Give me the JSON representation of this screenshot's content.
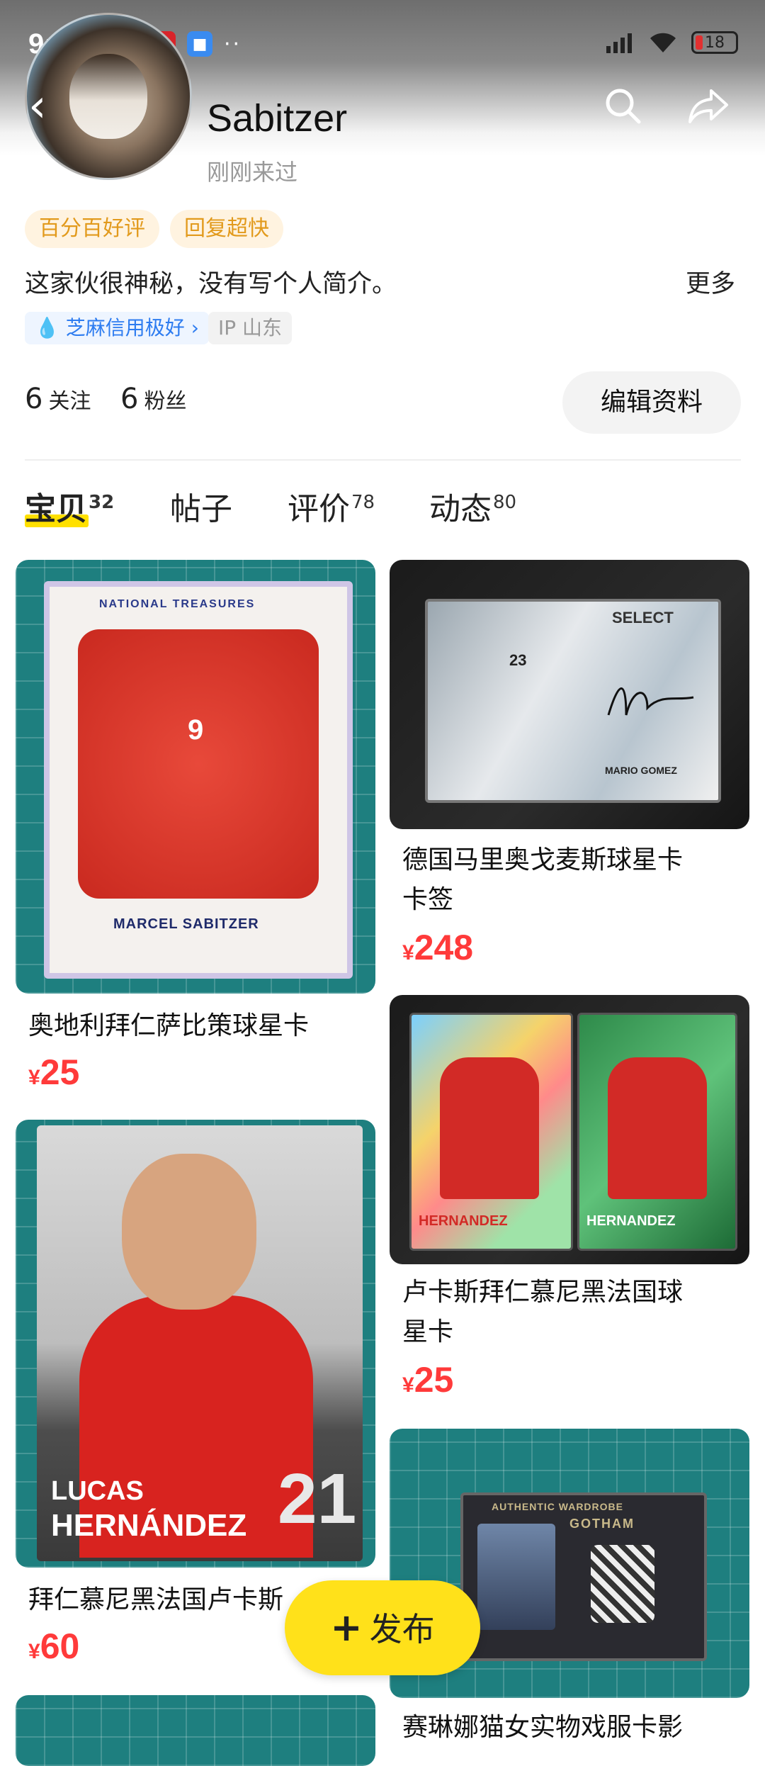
{
  "status_bar": {
    "time": "9:40",
    "battery": "18"
  },
  "profile": {
    "username": "Sabitzer",
    "last_seen": "刚刚来过",
    "tags": [
      "百分百好评",
      "回复超快"
    ],
    "bio": "这家伙很神秘，没有写个人简介。",
    "more_label": "更多",
    "credit_badge": "芝麻信用极好",
    "ip_label": "IP 山东",
    "following_count": "6",
    "following_label": "关注",
    "followers_count": "6",
    "followers_label": "粉丝",
    "edit_button": "编辑资料"
  },
  "tabs": [
    {
      "label": "宝贝",
      "count": "32",
      "active": true
    },
    {
      "label": "帖子",
      "count": ""
    },
    {
      "label": "评价",
      "count": "78"
    },
    {
      "label": "动态",
      "count": "80"
    }
  ],
  "items": [
    {
      "title": "奥地利拜仁萨比策球星卡",
      "currency": "¥",
      "price": "25"
    },
    {
      "title_line1": "德国马里奥戈麦斯球星卡",
      "title_line2": "卡签",
      "currency": "¥",
      "price": "248"
    },
    {
      "title": "拜仁慕尼黑法国卢卡斯",
      "currency": "¥",
      "price": "60"
    },
    {
      "title_line1": "卢卡斯拜仁慕尼黑法国球",
      "title_line2": "星卡",
      "currency": "¥",
      "price": "25"
    },
    {
      "title": "赛琳娜猫女实物戏服卡影"
    }
  ],
  "card_text": {
    "c1_top": "NATIONAL TREASURES",
    "c1_name": "MARCEL SABITZER",
    "c1_number": "9",
    "c2_brand": "SELECT",
    "c2_name": "MARIO GOMEZ",
    "c2_number": "23",
    "c3_name1": "LUCAS",
    "c3_name2": "HERNÁNDEZ",
    "c3_number": "21",
    "c4_name": "HERNANDEZ",
    "c5_top": "AUTHENTIC WARDROBE",
    "c5_brand": "GOTHAM"
  },
  "fab": {
    "label": "发布"
  },
  "colors": {
    "accent_yellow": "#ffe11a",
    "price_red": "#ff3a3a",
    "tag_orange": "#e29a1c",
    "credit_blue": "#2d7cf0"
  }
}
